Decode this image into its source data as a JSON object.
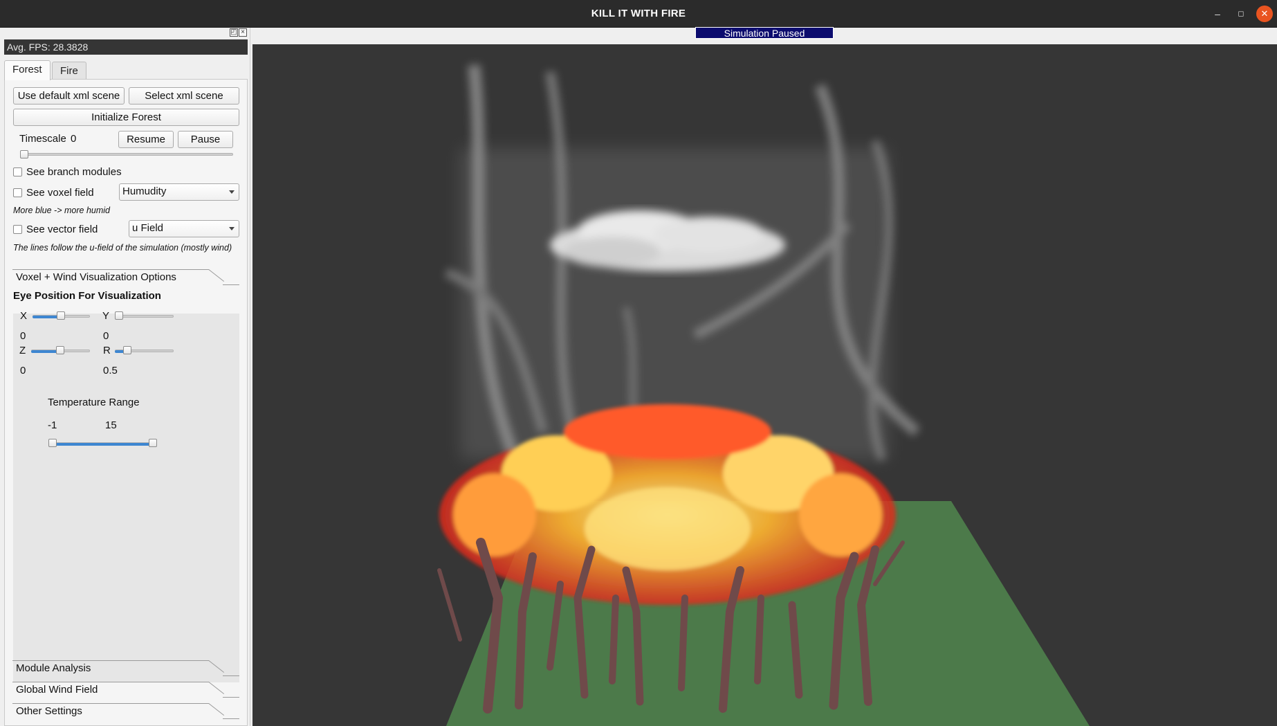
{
  "window": {
    "title": "KILL IT WITH FIRE",
    "minimize_glyph": "–",
    "maximize_glyph": "◻",
    "close_glyph": "✕"
  },
  "status_banner": "Simulation Paused",
  "panel": {
    "fps": "Avg. FPS: 28.3828",
    "tabs": [
      "Forest",
      "Fire"
    ],
    "buttons": {
      "use_default": "Use default xml scene",
      "select_xml": "Select xml scene",
      "initialize": "Initialize Forest",
      "resume": "Resume",
      "pause": "Pause"
    },
    "timescale": {
      "label": "Timescale",
      "value": "0",
      "level": 0
    },
    "see_branch_modules": "See branch modules",
    "see_voxel_field": "See voxel field",
    "voxel_combo": "Humudity",
    "voxel_note": "More blue -> more humid",
    "see_vector_field": "See vector field",
    "vector_combo": "u Field",
    "vector_note": "The lines follow the u-field of the simulation (mostly wind)",
    "sections": {
      "voxel_wind": "Voxel + Wind Visualization Options",
      "module_analysis": "Module Analysis",
      "global_wind": "Global Wind Field",
      "other_settings": "Other Settings"
    },
    "eye": {
      "heading": "Eye Position For Visualization",
      "x_label": "X",
      "x_value": "0",
      "y_label": "Y",
      "y_value": "0",
      "z_label": "Z",
      "z_value": "0",
      "r_label": "R",
      "r_value": "0.5"
    },
    "temperature": {
      "label": "Temperature Range",
      "min": "-1",
      "max": "15"
    }
  },
  "colors": {
    "viewport_bg": "#363636",
    "ground": "#4c7a4a",
    "status_bg": "#0c0c6e",
    "accent": "#3d86d1",
    "close": "#e95420"
  }
}
